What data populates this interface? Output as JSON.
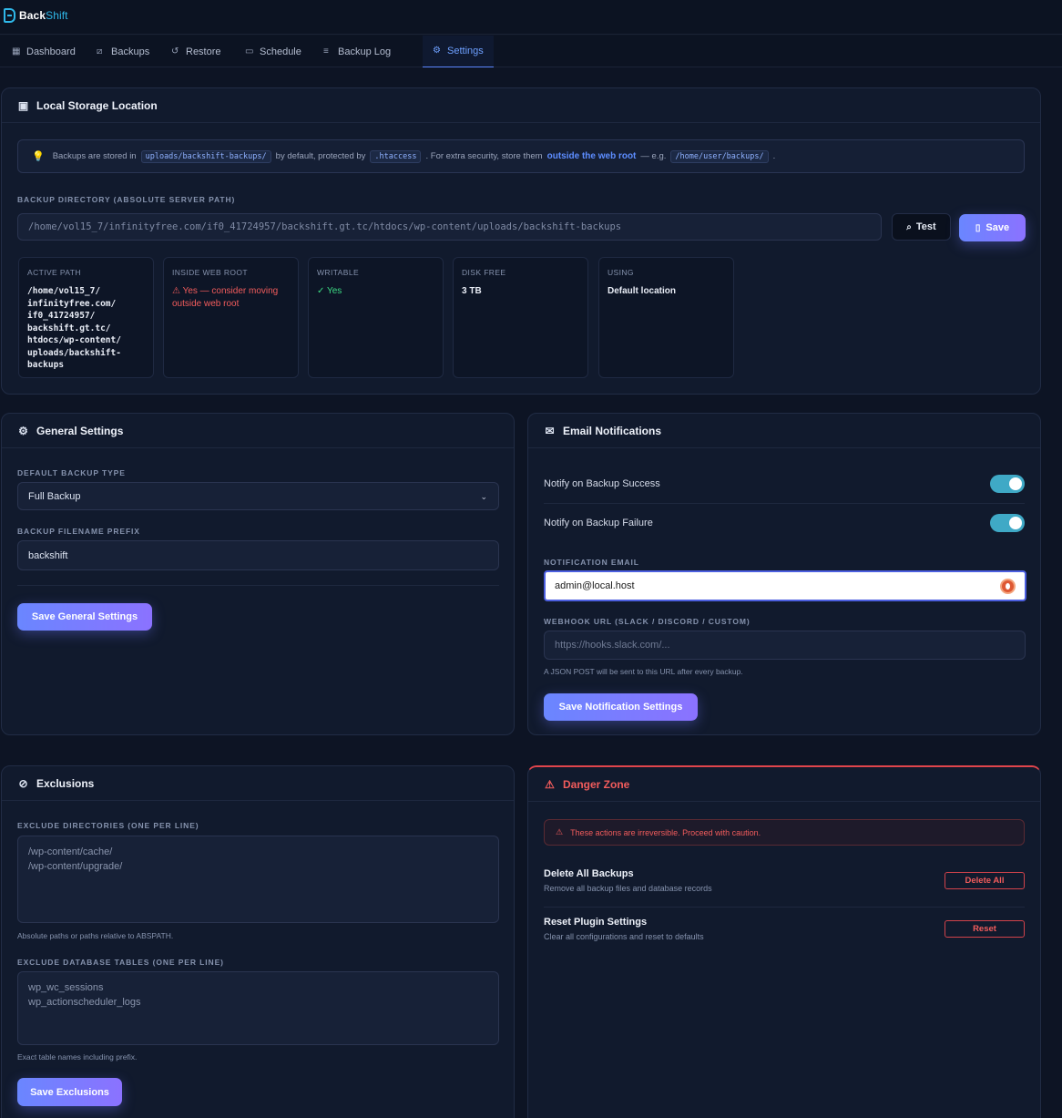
{
  "app": {
    "logo_part1": "Back",
    "logo_part2": "Shift"
  },
  "nav": [
    {
      "label": "Dashboard",
      "icon": "grid-icon"
    },
    {
      "label": "Backups",
      "icon": "archive-icon"
    },
    {
      "label": "Restore",
      "icon": "restore-icon"
    },
    {
      "label": "Schedule",
      "icon": "calendar-icon"
    },
    {
      "label": "Backup Log",
      "icon": "list-icon"
    },
    {
      "label": "Settings",
      "icon": "gear-icon",
      "active": true
    }
  ],
  "storage": {
    "title": "Local Storage Location",
    "info_1": "Backups are stored in",
    "info_code1": "uploads/backshift-backups/",
    "info_2": "by default, protected by",
    "info_code2": ".htaccess",
    "info_3": ". For extra security, store them",
    "info_link": "outside the web root",
    "info_4": "— e.g.",
    "info_code3": "/home/user/backups/",
    "info_5": ".",
    "dir_label": "Backup Directory (Absolute Server Path)",
    "dir_value": "/home/vol15_7/infinityfree.com/if0_41724957/backshift.gt.tc/htdocs/wp-content/uploads/backshift-backups",
    "test_label": "Test",
    "save_label": "Save",
    "stats": [
      {
        "label": "ACTIVE PATH",
        "value": "/home/vol15_7/\ninfinityfree.com/\nif0_41724957/\nbackshift.gt.tc/\nhtdocs/wp-content/\nuploads/backshift-\nbackups"
      },
      {
        "label": "INSIDE WEB ROOT",
        "value": "⚠ Yes — consider moving outside web root"
      },
      {
        "label": "WRITABLE",
        "value": "✓ Yes"
      },
      {
        "label": "DISK FREE",
        "value": "3 TB"
      },
      {
        "label": "USING",
        "value": "Default location"
      }
    ]
  },
  "general": {
    "title": "General Settings",
    "type_label": "Default Backup Type",
    "type_value": "Full Backup",
    "prefix_label": "Backup Filename Prefix",
    "prefix_value": "backshift",
    "save_label": "Save General Settings"
  },
  "email": {
    "title": "Email Notifications",
    "success_label": "Notify on Backup Success",
    "success_on": true,
    "failure_label": "Notify on Backup Failure",
    "failure_on": true,
    "email_label": "Notification Email",
    "email_value": "admin@local.host",
    "webhook_label": "Webhook URL (Slack / Discord / Custom)",
    "webhook_placeholder": "https://hooks.slack.com/...",
    "webhook_hint": "A JSON POST will be sent to this URL after every backup.",
    "save_label": "Save Notification Settings"
  },
  "exclusions": {
    "title": "Exclusions",
    "dirs_label": "Exclude Directories (One Per Line)",
    "dirs_value": "/wp-content/cache/\n/wp-content/upgrade/",
    "dirs_hint": "Absolute paths or paths relative to ABSPATH.",
    "tables_label": "Exclude Database Tables (One Per Line)",
    "tables_value": "wp_wc_sessions\nwp_actionscheduler_logs",
    "tables_hint": "Exact table names including prefix.",
    "save_label": "Save Exclusions"
  },
  "danger": {
    "title": "Danger Zone",
    "alert": "These actions are irreversible. Proceed with caution.",
    "delete_title": "Delete All Backups",
    "delete_sub": "Remove all backup files and database records",
    "delete_btn": "Delete All",
    "reset_title": "Reset Plugin Settings",
    "reset_sub": "Clear all configurations and reset to defaults",
    "reset_btn": "Reset"
  },
  "colors": {
    "accent": "#6a86ff",
    "danger": "#f25c5c",
    "success": "#3ddc84",
    "toggle_on": "#3fa9c6"
  }
}
